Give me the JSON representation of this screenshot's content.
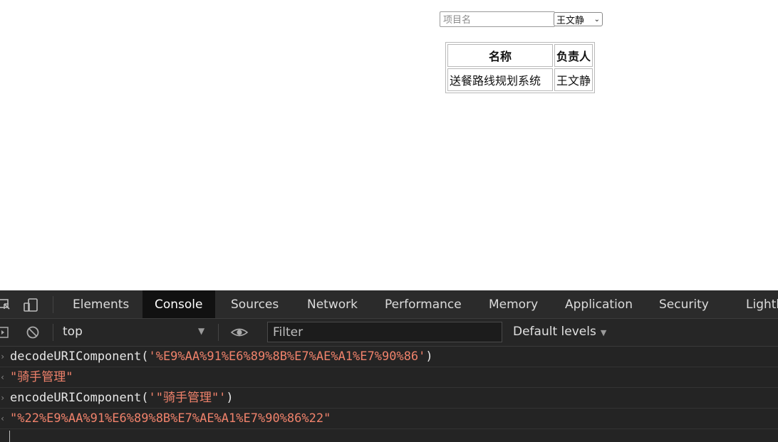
{
  "page": {
    "search": {
      "placeholder": "项目名",
      "value": ""
    },
    "owner_select": {
      "selected": "王文静"
    },
    "table": {
      "headers": [
        "名称",
        "负责人"
      ],
      "rows": [
        [
          "送餐路线规划系统",
          "王文静"
        ]
      ]
    }
  },
  "devtools": {
    "tabs": [
      {
        "label": "Elements",
        "active": false
      },
      {
        "label": "Console",
        "active": true
      },
      {
        "label": "Sources",
        "active": false
      },
      {
        "label": "Network",
        "active": false
      },
      {
        "label": "Performance",
        "active": false
      },
      {
        "label": "Memory",
        "active": false
      },
      {
        "label": "Application",
        "active": false
      },
      {
        "label": "Security",
        "active": false
      },
      {
        "label": "Lighth",
        "active": false
      }
    ],
    "toolbar": {
      "context": "top",
      "filter_placeholder": "Filter",
      "levels": "Default levels"
    },
    "console": [
      {
        "kind": "input",
        "fn": "decodeURIComponent(",
        "arg": "'%E9%AA%91%E6%89%8B%E7%AE%A1%E7%90%86'",
        "close": ")"
      },
      {
        "kind": "output",
        "value": "\"骑手管理\""
      },
      {
        "kind": "input",
        "fn": "encodeURIComponent(",
        "arg": "'\"骑手管理\"'",
        "close": ")"
      },
      {
        "kind": "output",
        "value": "\"%22%E9%AA%91%E6%89%8B%E7%AE%A1%E7%90%86%22\""
      }
    ],
    "colors": {
      "string": "#f0826b",
      "active_tab_bg": "#111111",
      "panel_bg": "#242424"
    }
  }
}
